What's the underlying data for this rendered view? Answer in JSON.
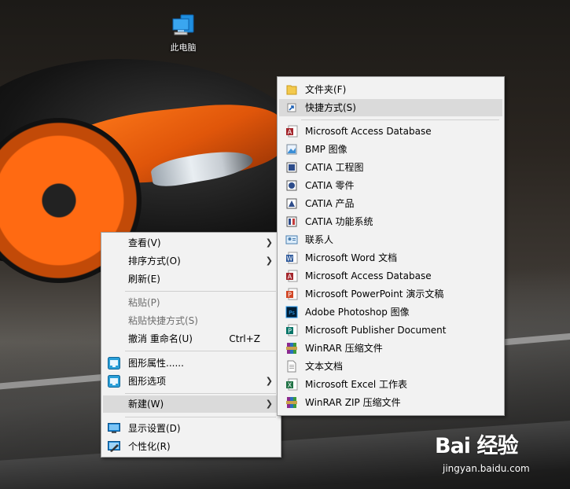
{
  "desktop": {
    "icon_label": "此电脑"
  },
  "context_menu": {
    "items": [
      {
        "label": "查看(V)",
        "has_submenu": true
      },
      {
        "label": "排序方式(O)",
        "has_submenu": true
      },
      {
        "label": "刷新(E)"
      },
      {
        "label": "粘贴(P)",
        "disabled": true
      },
      {
        "label": "粘贴快捷方式(S)",
        "disabled": true
      },
      {
        "label": "撤消 重命名(U)",
        "shortcut": "Ctrl+Z"
      },
      {
        "label": "图形属性......"
      },
      {
        "label": "图形选项",
        "has_submenu": true
      },
      {
        "label": "新建(W)",
        "has_submenu": true,
        "hovered": true
      },
      {
        "label": "显示设置(D)"
      },
      {
        "label": "个性化(R)"
      }
    ],
    "arrow_glyph": "❯"
  },
  "new_submenu": {
    "items": [
      {
        "label": "文件夹(F)",
        "icon": "folder-icon"
      },
      {
        "label": "快捷方式(S)",
        "icon": "shortcut-icon",
        "hovered": true
      },
      {
        "label": "Microsoft Access Database",
        "icon": "access-icon"
      },
      {
        "label": "BMP 图像",
        "icon": "bmp-image-icon"
      },
      {
        "label": "CATIA 工程图",
        "icon": "catia-drawing-icon"
      },
      {
        "label": "CATIA 零件",
        "icon": "catia-part-icon"
      },
      {
        "label": "CATIA 产品",
        "icon": "catia-product-icon"
      },
      {
        "label": "CATIA 功能系统",
        "icon": "catia-function-icon"
      },
      {
        "label": "联系人",
        "icon": "contact-icon"
      },
      {
        "label": "Microsoft Word 文档",
        "icon": "word-icon"
      },
      {
        "label": "Microsoft Access Database",
        "icon": "access-icon"
      },
      {
        "label": "Microsoft PowerPoint 演示文稿",
        "icon": "powerpoint-icon"
      },
      {
        "label": "Adobe Photoshop 图像",
        "icon": "photoshop-icon"
      },
      {
        "label": "Microsoft Publisher Document",
        "icon": "publisher-icon"
      },
      {
        "label": "WinRAR 压缩文件",
        "icon": "winrar-icon"
      },
      {
        "label": "文本文档",
        "icon": "text-document-icon"
      },
      {
        "label": "Microsoft Excel 工作表",
        "icon": "excel-icon"
      },
      {
        "label": "WinRAR ZIP 压缩文件",
        "icon": "winrar-zip-icon"
      }
    ]
  },
  "watermark": {
    "logo": "Bai 经验",
    "site": "jingyan.baidu.com"
  },
  "colors": {
    "menu_bg": "#f2f2f2",
    "hover_bg": "#dadada",
    "disabled_text": "#6d6d6d",
    "car_orange": "#ff7a1a"
  }
}
